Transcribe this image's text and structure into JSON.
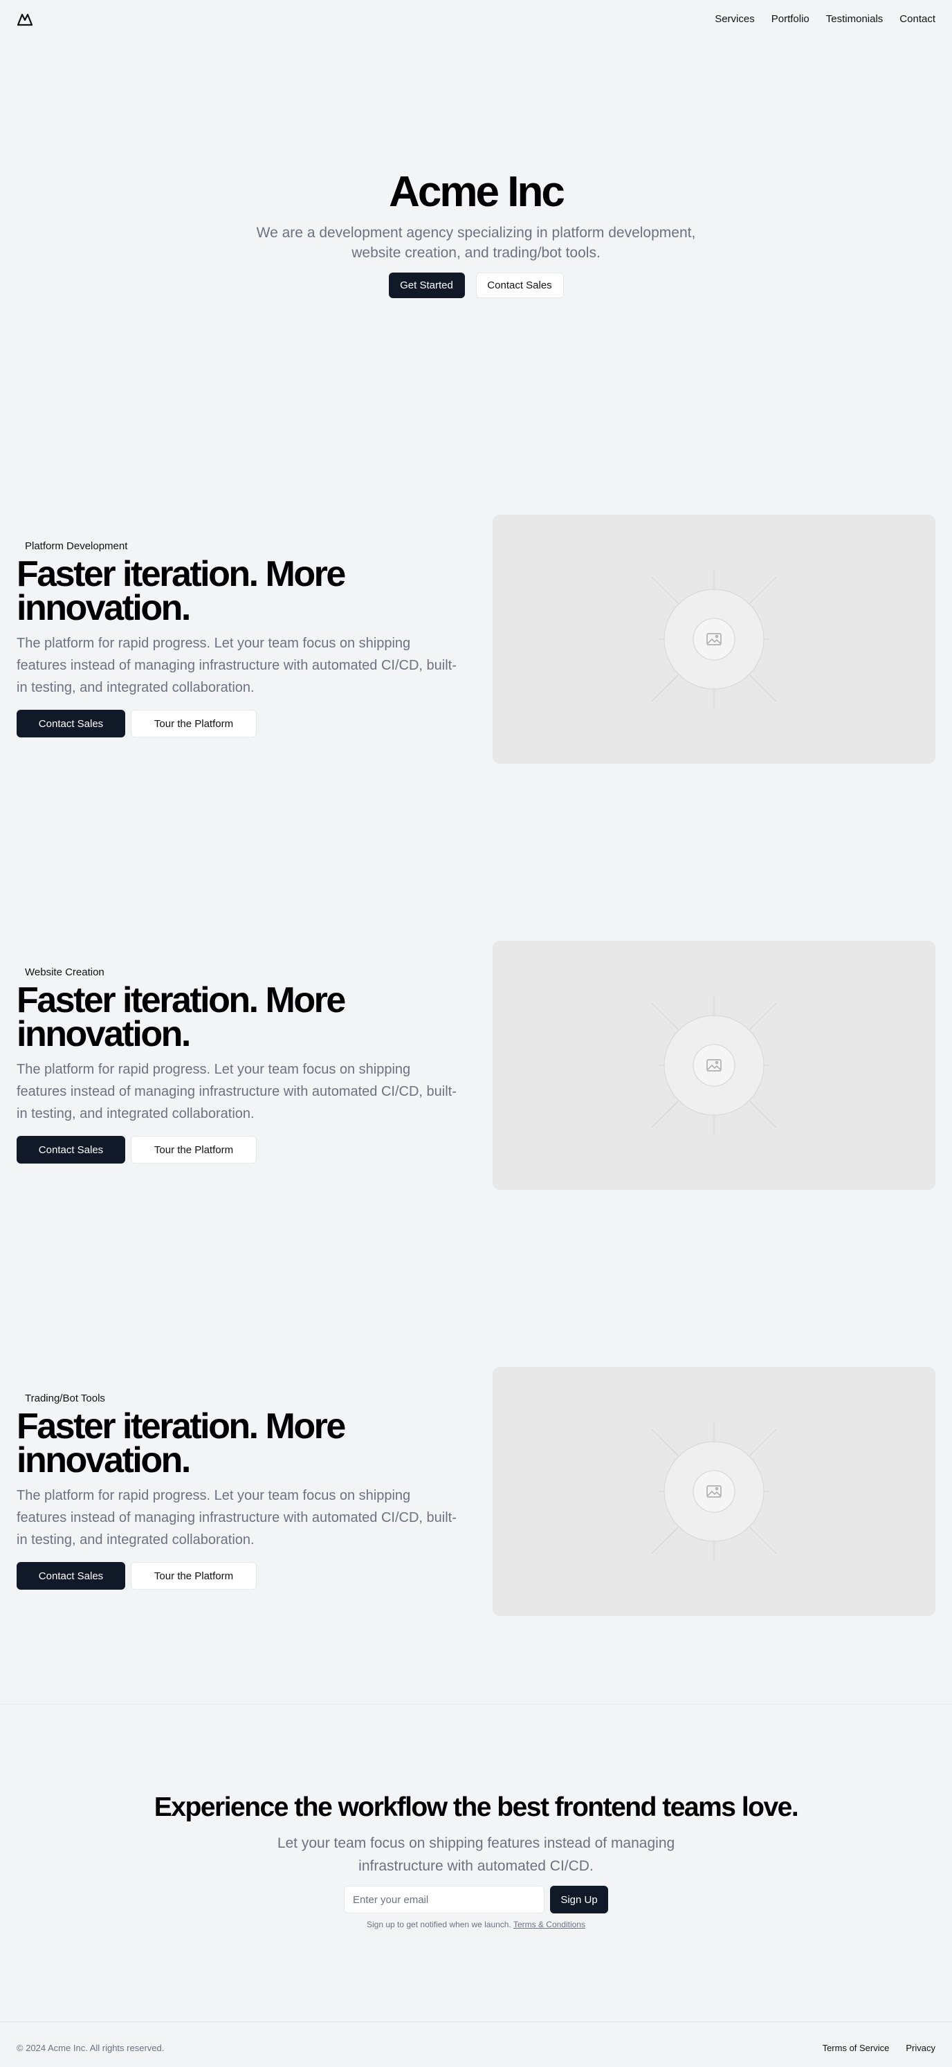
{
  "nav": {
    "links": [
      "Services",
      "Portfolio",
      "Testimonials",
      "Contact"
    ]
  },
  "hero": {
    "title": "Acme Inc",
    "subtitle": "We are a development agency specializing in platform development, website creation, and trading/bot tools.",
    "primary_button": "Get Started",
    "secondary_button": "Contact Sales"
  },
  "features": [
    {
      "tag": "Platform Development",
      "title": "Faster iteration. More innovation.",
      "description": "The platform for rapid progress. Let your team focus on shipping features instead of managing infrastructure with automated CI/CD, built-in testing, and integrated collaboration.",
      "primary_button": "Contact Sales",
      "secondary_button": "Tour the Platform",
      "image_icon": "image-placeholder-icon"
    },
    {
      "tag": "Website Creation",
      "title": "Faster iteration. More innovation.",
      "description": "The platform for rapid progress. Let your team focus on shipping features instead of managing infrastructure with automated CI/CD, built-in testing, and integrated collaboration.",
      "primary_button": "Contact Sales",
      "secondary_button": "Tour the Platform",
      "image_icon": "image-placeholder-icon"
    },
    {
      "tag": "Trading/Bot Tools",
      "title": "Faster iteration. More innovation.",
      "description": "The platform for rapid progress. Let your team focus on shipping features instead of managing infrastructure with automated CI/CD, built-in testing, and integrated collaboration.",
      "primary_button": "Contact Sales",
      "secondary_button": "Tour the Platform",
      "image_icon": "image-placeholder-icon"
    }
  ],
  "cta": {
    "title": "Experience the workflow the best frontend teams love.",
    "subtitle": "Let your team focus on shipping features instead of managing infrastructure with automated CI/CD.",
    "email_placeholder": "Enter your email",
    "button": "Sign Up",
    "note": "Sign up to get notified when we launch.",
    "terms_link": "Terms & Conditions"
  },
  "footer": {
    "copyright": "© 2024 Acme Inc. All rights reserved.",
    "links": [
      "Terms of Service",
      "Privacy"
    ]
  },
  "colors": {
    "background": "#f3f4f6",
    "primary_button": "#111827",
    "muted_text": "#6b7280",
    "placeholder_bg": "#e8e8e8"
  }
}
